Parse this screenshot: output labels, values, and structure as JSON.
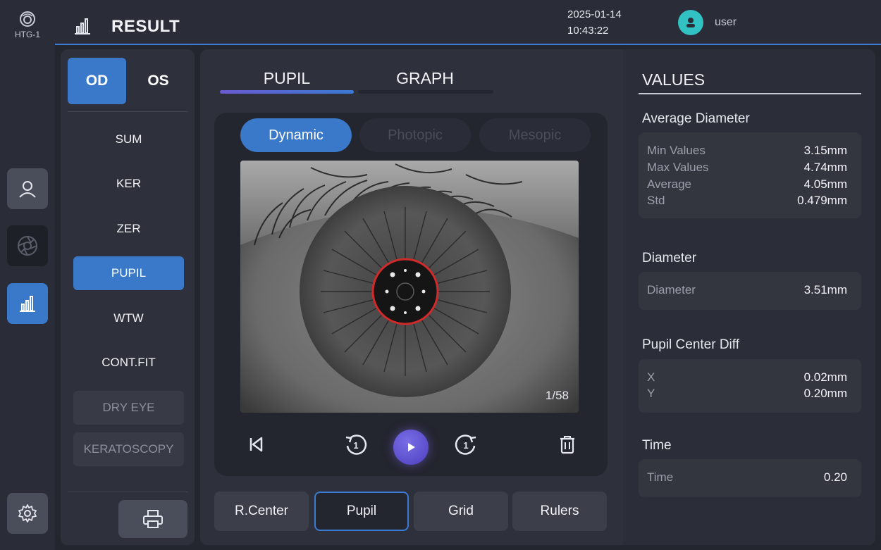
{
  "app": {
    "logo_text": "HTG-1"
  },
  "header": {
    "title": "RESULT",
    "date": "2025-01-14",
    "time": "10:43:22",
    "username": "user"
  },
  "rail": {
    "items": [
      {
        "icon": "user-icon"
      },
      {
        "icon": "aperture-icon"
      },
      {
        "icon": "bar-chart-icon",
        "active": true
      },
      {
        "icon": "gear-icon"
      }
    ]
  },
  "eye_toggle": {
    "od": "OD",
    "os": "OS",
    "selected": "OD"
  },
  "menu": {
    "items": [
      {
        "label": "SUM",
        "state": "normal"
      },
      {
        "label": "KER",
        "state": "normal"
      },
      {
        "label": "ZER",
        "state": "normal"
      },
      {
        "label": "PUPIL",
        "state": "active"
      },
      {
        "label": "WTW",
        "state": "normal"
      },
      {
        "label": "CONT.FIT",
        "state": "normal"
      },
      {
        "label": "DRY EYE",
        "state": "disabled"
      },
      {
        "label": "KERATOSCOPY",
        "state": "disabled"
      }
    ],
    "print_icon": "printer-icon"
  },
  "tabs": [
    {
      "label": "PUPIL",
      "active": true
    },
    {
      "label": "GRAPH",
      "active": false
    }
  ],
  "modes": [
    {
      "label": "Dynamic",
      "active": true
    },
    {
      "label": "Photopic",
      "active": false
    },
    {
      "label": "Mesopic",
      "active": false
    }
  ],
  "viewer": {
    "frame_counter": "1/58"
  },
  "playback": {
    "first_icon": "skip-to-start-icon",
    "back_icon": "rewind-1-icon",
    "play_icon": "play-icon",
    "forward_icon": "forward-1-icon",
    "delete_icon": "trash-icon"
  },
  "tools": [
    {
      "label": "R.Center",
      "active": false
    },
    {
      "label": "Pupil",
      "active": true
    },
    {
      "label": "Grid",
      "active": false
    },
    {
      "label": "Rulers",
      "active": false
    }
  ],
  "values": {
    "title": "VALUES",
    "average_diameter": {
      "title": "Average Diameter",
      "rows": [
        {
          "label": "Min Values",
          "value": "3.15mm"
        },
        {
          "label": "Max Values",
          "value": "4.74mm"
        },
        {
          "label": "Average",
          "value": "4.05mm"
        },
        {
          "label": "Std",
          "value": "0.479mm"
        }
      ]
    },
    "diameter": {
      "title": "Diameter",
      "rows": [
        {
          "label": "Diameter",
          "value": "3.51mm"
        }
      ]
    },
    "pupil_center_diff": {
      "title": "Pupil Center Diff",
      "rows": [
        {
          "label": "X",
          "value": "0.02mm"
        },
        {
          "label": "Y",
          "value": "0.20mm"
        }
      ]
    },
    "time": {
      "title": "Time",
      "rows": [
        {
          "label": "Time",
          "value": "0.20"
        }
      ]
    }
  },
  "colors": {
    "accent": "#3a78c9",
    "background": "#23252f",
    "panel": "#2e303b",
    "avatar": "#32c2c4",
    "pupil_outline": "#d22a2a"
  }
}
